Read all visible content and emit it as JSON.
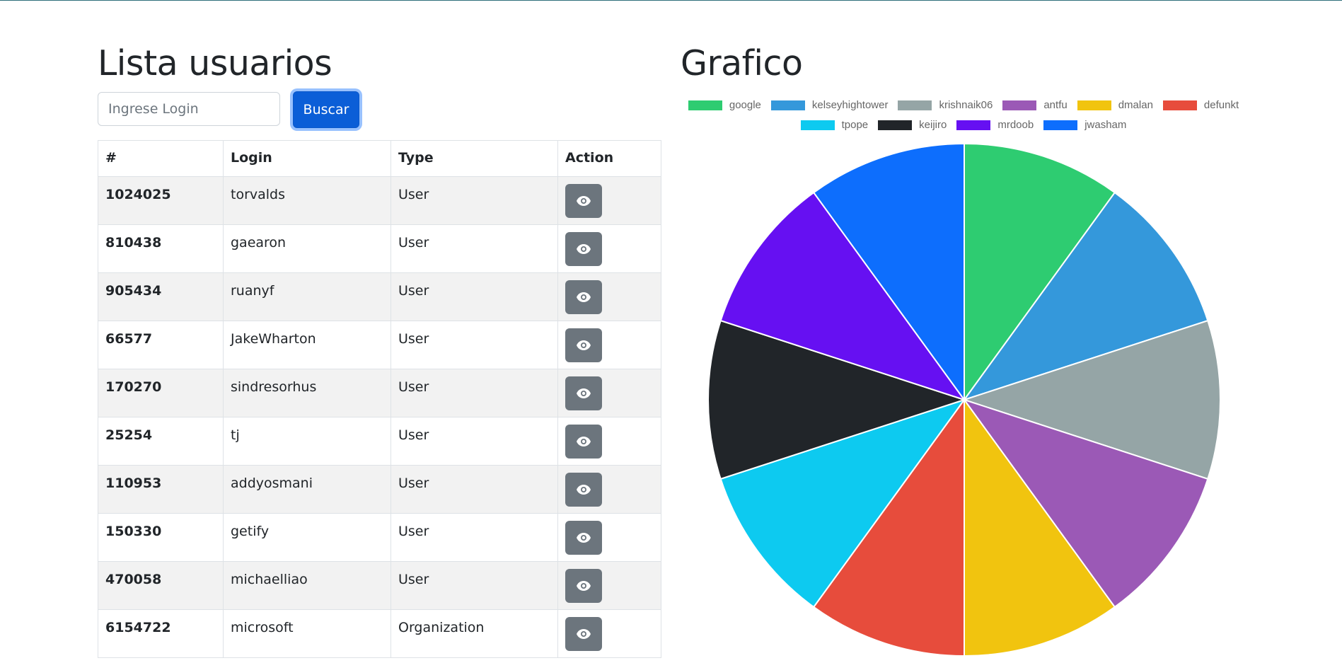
{
  "left": {
    "title": "Lista usuarios",
    "search_placeholder": "Ingrese Login",
    "search_value": "",
    "search_button": "Buscar"
  },
  "table": {
    "headers": [
      "#",
      "Login",
      "Type",
      "Action"
    ],
    "rows": [
      {
        "id": "1024025",
        "login": "torvalds",
        "type": "User"
      },
      {
        "id": "810438",
        "login": "gaearon",
        "type": "User"
      },
      {
        "id": "905434",
        "login": "ruanyf",
        "type": "User"
      },
      {
        "id": "66577",
        "login": "JakeWharton",
        "type": "User"
      },
      {
        "id": "170270",
        "login": "sindresorhus",
        "type": "User"
      },
      {
        "id": "25254",
        "login": "tj",
        "type": "User"
      },
      {
        "id": "110953",
        "login": "addyosmani",
        "type": "User"
      },
      {
        "id": "150330",
        "login": "getify",
        "type": "User"
      },
      {
        "id": "470058",
        "login": "michaelliao",
        "type": "User"
      },
      {
        "id": "6154722",
        "login": "microsoft",
        "type": "Organization"
      }
    ],
    "action_icon": "eye-icon"
  },
  "right": {
    "title": "Grafico"
  },
  "chart_data": {
    "type": "pie",
    "title": "",
    "legend_placement": "top",
    "categories": [
      "google",
      "kelseyhightower",
      "krishnaik06",
      "antfu",
      "dmalan",
      "defunkt",
      "tpope",
      "keijiro",
      "mrdoob",
      "jwasham"
    ],
    "values": [
      1,
      1,
      1,
      1,
      1,
      1,
      1,
      1,
      1,
      1
    ],
    "colors": [
      "#2ecc71",
      "#3498db",
      "#95a5a6",
      "#9b59b6",
      "#f1c40f",
      "#e74c3c",
      "#0dcaf0",
      "#212529",
      "#6610f2",
      "#0d6efd"
    ]
  },
  "colors": {
    "primary_button": "#0b5ed7",
    "action_button": "#6c757d",
    "striped_row": "#f2f2f2"
  }
}
